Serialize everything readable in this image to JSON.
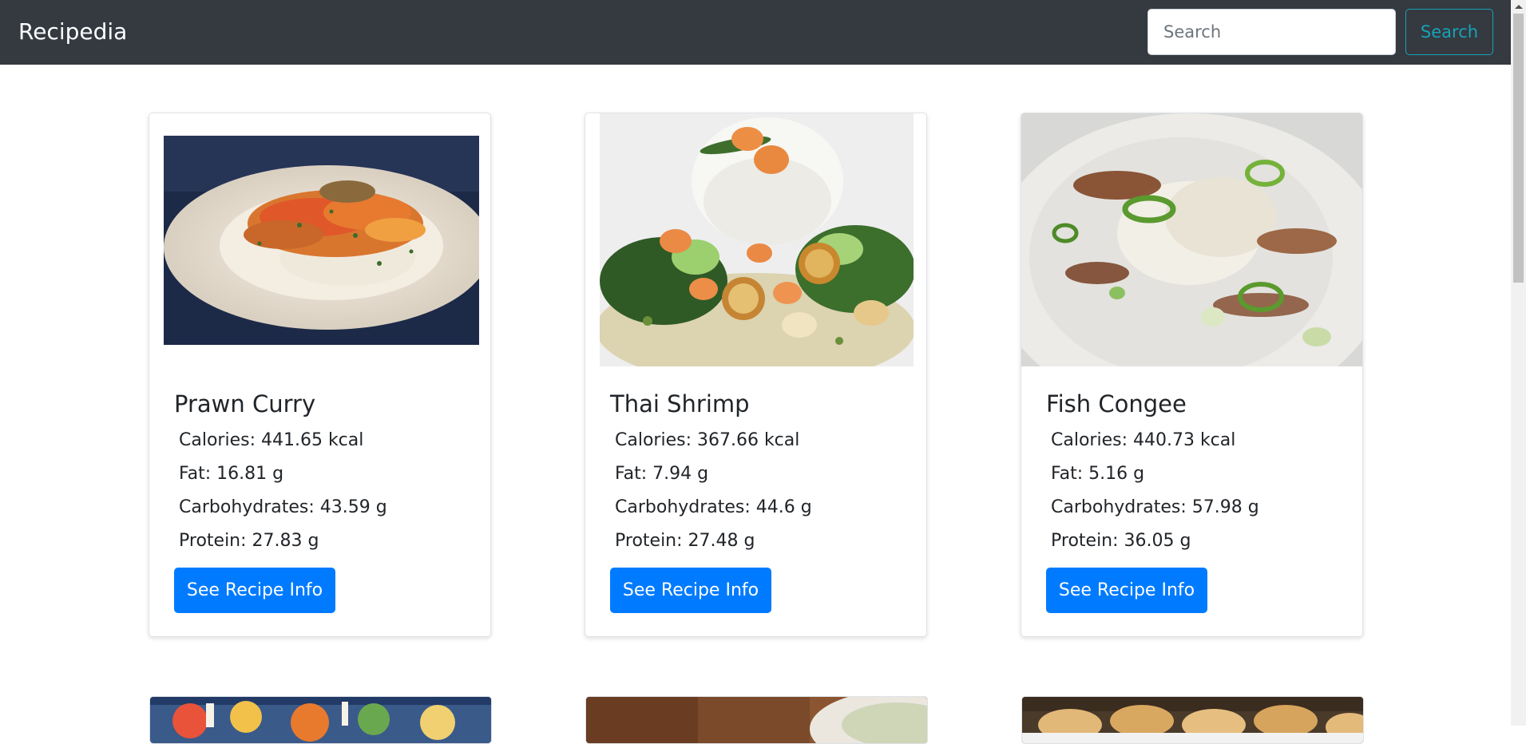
{
  "navbar": {
    "brand": "Recipedia",
    "search_placeholder": "Search",
    "search_button": "Search"
  },
  "recipes": [
    {
      "title": "Prawn Curry",
      "calories": "Calories: 441.65 kcal",
      "fat": "Fat: 16.81 g",
      "carbs": "Carbohydrates: 43.59 g",
      "protein": "Protein: 27.83 g",
      "button": "See Recipe Info"
    },
    {
      "title": "Thai Shrimp",
      "calories": "Calories: 367.66 kcal",
      "fat": "Fat: 7.94 g",
      "carbs": "Carbohydrates: 44.6 g",
      "protein": "Protein: 27.48 g",
      "button": "See Recipe Info"
    },
    {
      "title": "Fish Congee",
      "calories": "Calories: 440.73 kcal",
      "fat": "Fat: 5.16 g",
      "carbs": "Carbohydrates: 57.98 g",
      "protein": "Protein: 36.05 g",
      "button": "See Recipe Info"
    }
  ],
  "colors": {
    "navbar_bg": "#343a40",
    "primary": "#007bff",
    "info": "#17a2b8"
  }
}
